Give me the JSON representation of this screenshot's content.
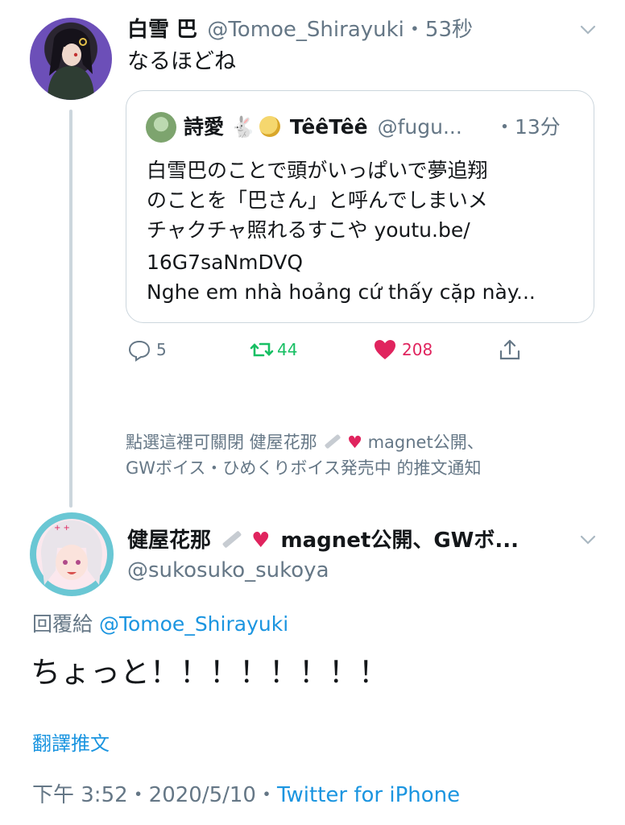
{
  "tweet": {
    "author_name": "白雪 巴",
    "author_handle": "@Tomoe_Shirayuki",
    "time": "・53秒",
    "text": "なるほどね"
  },
  "quote": {
    "author_name": "詩愛",
    "author_name2": "TêêTêê",
    "author_handle": "@fugu...",
    "time": "・13分",
    "lines": [
      "白雪巴のことで頭がいっぱいで夢追翔",
      "のことを「巴さん」と呼んでしまいメ",
      "チャクチャ照れるすこや youtu.be/",
      "16G7saNmDVQ",
      "Nghe em nhà hoảng cứ thấy cặp này..."
    ]
  },
  "actions": {
    "reply_count": "5",
    "retweet_count": "44",
    "like_count": "208"
  },
  "notice": {
    "line1": "點選這裡可關閉 健屋花那",
    "line1b": "magnet公開、",
    "line2": "GWボイス・ひめくりボイス発売中 的推文通知"
  },
  "reply": {
    "author_name": "健屋花那",
    "author_name_rest": "magnet公開、GWボ...",
    "author_handle": "@sukosuko_sukoya",
    "reply_to_label": "回覆給",
    "reply_to_handle": "@Tomoe_Shirayuki",
    "text": "ちょっと！！！！！！！！",
    "translate": "翻譯推文",
    "timestamp": "下午 3:52・2020/5/10・",
    "source": "Twitter for iPhone"
  },
  "colors": {
    "accent": "#1b95e0",
    "retweet": "#17bf63",
    "like": "#e0245e",
    "muted": "#657786"
  }
}
